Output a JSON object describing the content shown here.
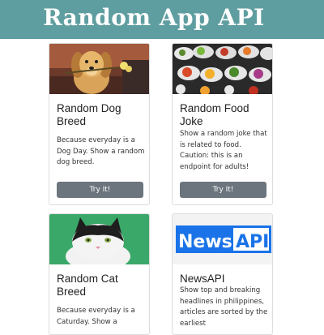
{
  "header": {
    "title": "Random App API"
  },
  "cards": [
    {
      "title": "Random Dog Breed",
      "text": "Because everyday is a Dog Day. Show a random dog breed.",
      "button": "Try It!",
      "image_icon": "dog-photo"
    },
    {
      "title": "Random Food Joke",
      "text": "Show a random joke that is related to food. Caution: this is an endpoint for adults!",
      "button": "Try It!",
      "image_icon": "food-photo"
    },
    {
      "title": "Random Cat Breed",
      "text": "Because everyday is a Caturday. Show a",
      "image_icon": "cat-photo"
    },
    {
      "title": "NewsAPI",
      "text": "Show top and breaking headlines in philippines, articles are sorted by the earliest",
      "image_icon": "newsapi-logo",
      "logo_text_left": "News",
      "logo_text_right": "API"
    }
  ],
  "colors": {
    "header_bg": "#5f9ea0",
    "button_bg": "#6c757d",
    "newsapi_blue": "#1a73e8"
  }
}
